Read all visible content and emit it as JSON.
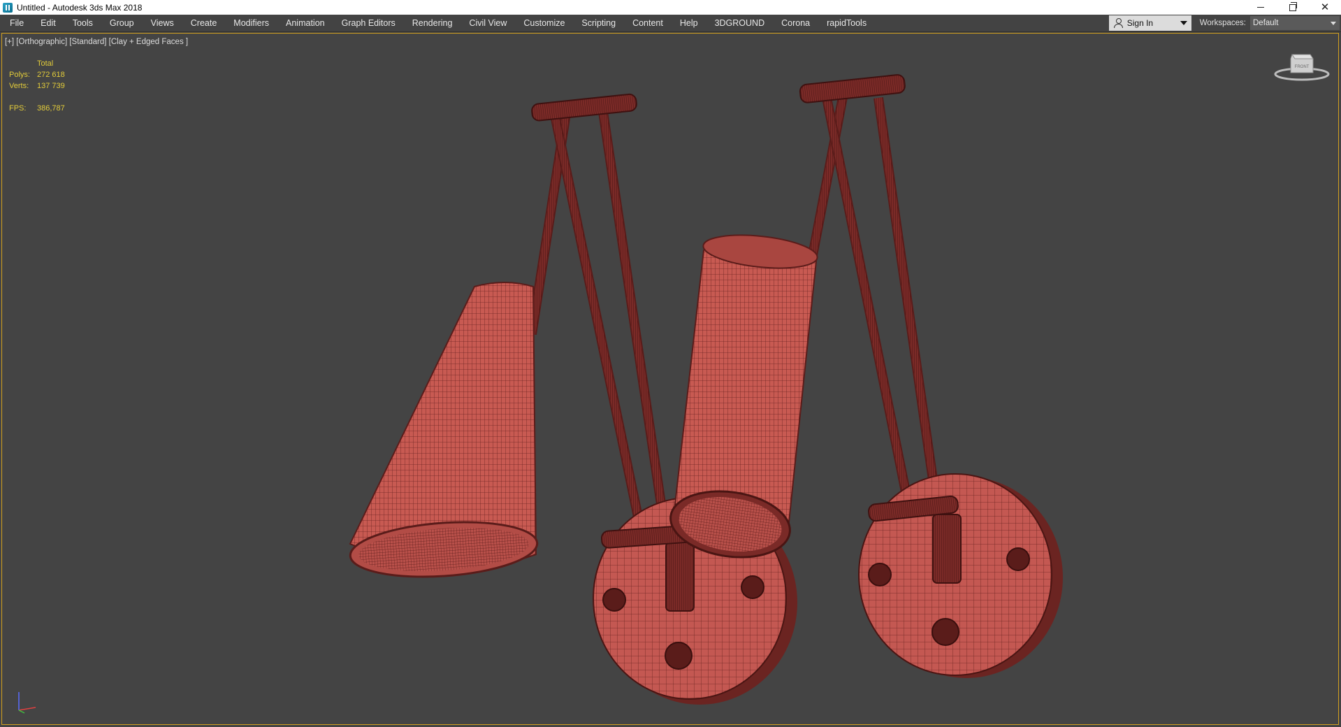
{
  "window": {
    "title": "Untitled - Autodesk 3ds Max 2018"
  },
  "menu": {
    "items": [
      "File",
      "Edit",
      "Tools",
      "Group",
      "Views",
      "Create",
      "Modifiers",
      "Animation",
      "Graph Editors",
      "Rendering",
      "Civil View",
      "Customize",
      "Scripting",
      "Content",
      "Help",
      "3DGROUND",
      "Corona",
      "rapidTools"
    ],
    "sign_in": "Sign In",
    "workspaces_label": "Workspaces:",
    "workspace_value": "Default"
  },
  "viewport": {
    "label": "[+] [Orthographic] [Standard] [Clay + Edged Faces ]",
    "stats": {
      "header": "Total",
      "polys_label": "Polys:",
      "polys_value": "272 618",
      "verts_label": "Verts:",
      "verts_value": "137 739",
      "fps_label": "FPS:",
      "fps_value": "386,787"
    },
    "viewcube_label": "FRONT"
  },
  "colors": {
    "viewport_bg": "#444444",
    "active_border": "#d2a01f",
    "stats_text": "#e3cc3a",
    "clay_fill": "#c85a52",
    "wire": "#5a1c1a"
  }
}
